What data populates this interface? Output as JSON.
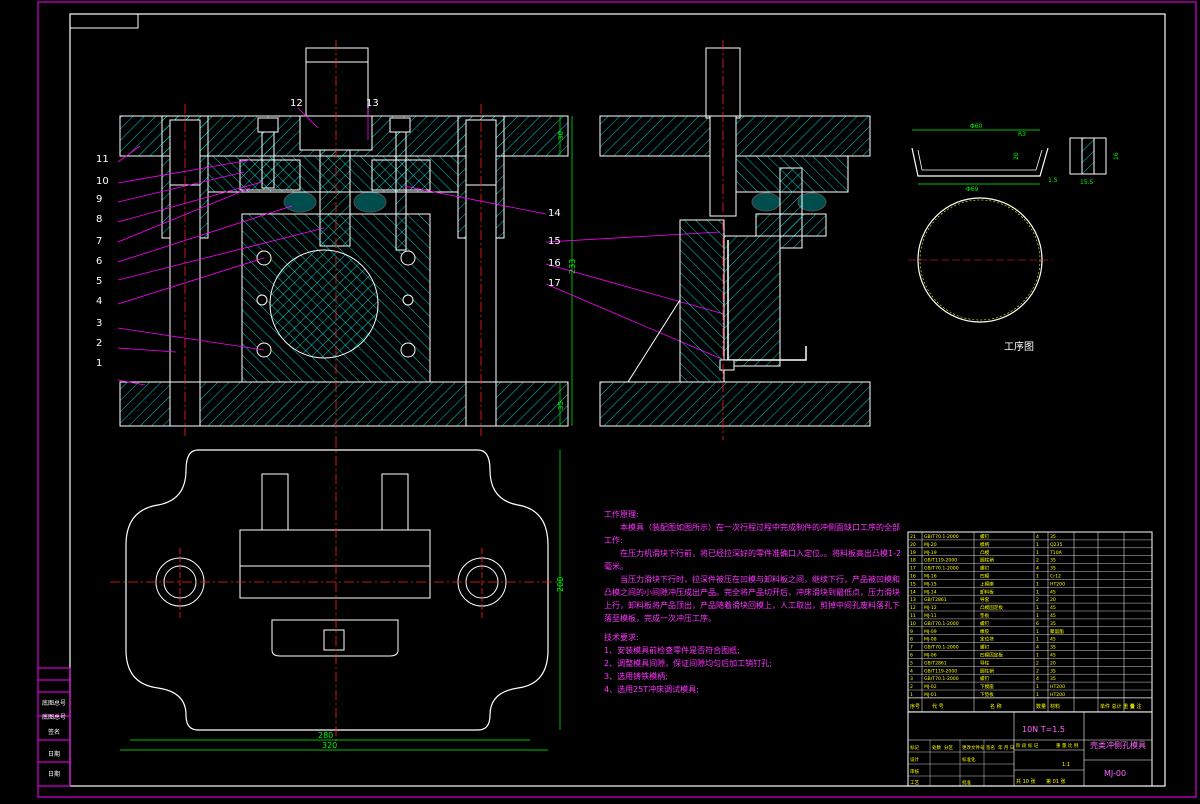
{
  "colors": {
    "background": "#000000",
    "border": "#ff00ff",
    "outline": "#ffffff",
    "hatch": "#00ffff",
    "centerline": "#ff2020",
    "dimension": "#00ff00",
    "leader": "#ff00ff",
    "note_text": "#ff33ff",
    "callout_text": "#ffffff"
  },
  "part_callouts": [
    "1",
    "2",
    "3",
    "4",
    "5",
    "6",
    "7",
    "8",
    "9",
    "10",
    "11",
    "12",
    "13",
    "14",
    "15",
    "16",
    "17"
  ],
  "dimensions": {
    "front_height_total": "233",
    "top_plate_thickness": "30",
    "bottom_plate_thickness": "35",
    "plan_width_inner": "280",
    "plan_width_outer": "320",
    "plan_height": "200",
    "part_width": "Φ69",
    "part_top": "Φ60",
    "part_flange": "R3",
    "part_height": "20",
    "part_wall": "1.5",
    "detail_height": "16",
    "detail_width": "15.5"
  },
  "process_label": "工序图",
  "notes": {
    "heading": "工作原理:",
    "paragraphs": [
      "本模具（装配图如图所示）在一次行程过程中完成制件的冲侧面缺口工序的全部工作:",
      "在压力机滑块下行前，将已经拉深好的零件准确口入定位。。将料板高出凸模1-2毫米。",
      "当压力滑块下行时，拉深件被压在凹模与卸料板之间，继续下行，产品被凹模和凸模之间的小间隙冲压成出产品。完全将产品切开后，冲床滑块到最低点，压力滑块上行，卸料板将产品顶出，产品随着滑块回模上，人工取出，剪掉中间孔废料落孔下落至模板，完成一次冲压工序。"
    ],
    "req_heading": "技术要求:",
    "requirements": [
      "1、安装模具前检查零件是否符合图纸;",
      "2、调整模具间隙，保证间隙均匀后加工销钉孔;",
      "3、选用铸铁模柄;",
      "4、选用25T冲床调试模具;"
    ]
  },
  "title_block": {
    "press_spec": "10N T=1.5",
    "drawing_title": "壳类冲侧孔模具",
    "drawing_number": "MJ-00",
    "scale": "1:1",
    "sheet_total": "共 10 张",
    "sheet_no": "第 01 张",
    "header_cells": [
      "序号",
      "代 号",
      "名 称",
      "数量",
      "材料",
      "单件 总计 重 量",
      "备 注"
    ],
    "bottom_labels": [
      "标记",
      "处数",
      "分区",
      "更改文件号",
      "签名",
      "年 月 日",
      "设计",
      "标准化",
      "审核",
      "工艺",
      "批准",
      "阶 段 标 记",
      "重 量",
      "比 例"
    ]
  },
  "bom_rows": [
    {
      "no": "21",
      "code": "GB/T70.1-2000",
      "name": "螺钉",
      "qty": "4",
      "mat": "35"
    },
    {
      "no": "20",
      "code": "MJ-20",
      "name": "模柄",
      "qty": "1",
      "mat": "Q235"
    },
    {
      "no": "19",
      "code": "MJ-19",
      "name": "凸模",
      "qty": "1",
      "mat": "T10A"
    },
    {
      "no": "18",
      "code": "GB/T119-2000",
      "name": "圆柱销",
      "qty": "2",
      "mat": "35"
    },
    {
      "no": "17",
      "code": "GB/T70.1-2000",
      "name": "螺钉",
      "qty": "4",
      "mat": "35"
    },
    {
      "no": "16",
      "code": "MJ-16",
      "name": "凹模",
      "qty": "1",
      "mat": "Cr12"
    },
    {
      "no": "15",
      "code": "MJ-15",
      "name": "上模座",
      "qty": "1",
      "mat": "HT200"
    },
    {
      "no": "14",
      "code": "MJ-14",
      "name": "卸料板",
      "qty": "1",
      "mat": "45"
    },
    {
      "no": "13",
      "code": "GB/T2861",
      "name": "导套",
      "qty": "2",
      "mat": "20"
    },
    {
      "no": "12",
      "code": "MJ-12",
      "name": "凸模固定板",
      "qty": "1",
      "mat": "45"
    },
    {
      "no": "11",
      "code": "MJ-11",
      "name": "垫板",
      "qty": "1",
      "mat": "45"
    },
    {
      "no": "10",
      "code": "GB/T70.1-2000",
      "name": "螺钉",
      "qty": "6",
      "mat": "35"
    },
    {
      "no": "9",
      "code": "MJ-09",
      "name": "橡胶",
      "qty": "1",
      "mat": "聚氨酯"
    },
    {
      "no": "8",
      "code": "MJ-08",
      "name": "定位块",
      "qty": "1",
      "mat": "45"
    },
    {
      "no": "7",
      "code": "GB/T70.1-2000",
      "name": "螺钉",
      "qty": "4",
      "mat": "35"
    },
    {
      "no": "6",
      "code": "MJ-06",
      "name": "凹模固定板",
      "qty": "1",
      "mat": "45"
    },
    {
      "no": "5",
      "code": "GB/T2861",
      "name": "导柱",
      "qty": "2",
      "mat": "20"
    },
    {
      "no": "4",
      "code": "GB/T119-2000",
      "name": "圆柱销",
      "qty": "2",
      "mat": "35"
    },
    {
      "no": "3",
      "code": "GB/T70.1-2000",
      "name": "螺钉",
      "qty": "4",
      "mat": "35"
    },
    {
      "no": "2",
      "code": "MJ-02",
      "name": "下模座",
      "qty": "1",
      "mat": "HT200"
    },
    {
      "no": "1",
      "code": "MJ-01",
      "name": "下垫板",
      "qty": "1",
      "mat": "HT200"
    }
  ],
  "left_strip": [
    "底图总号",
    "底图总号",
    "签名",
    "日期",
    "日期"
  ]
}
